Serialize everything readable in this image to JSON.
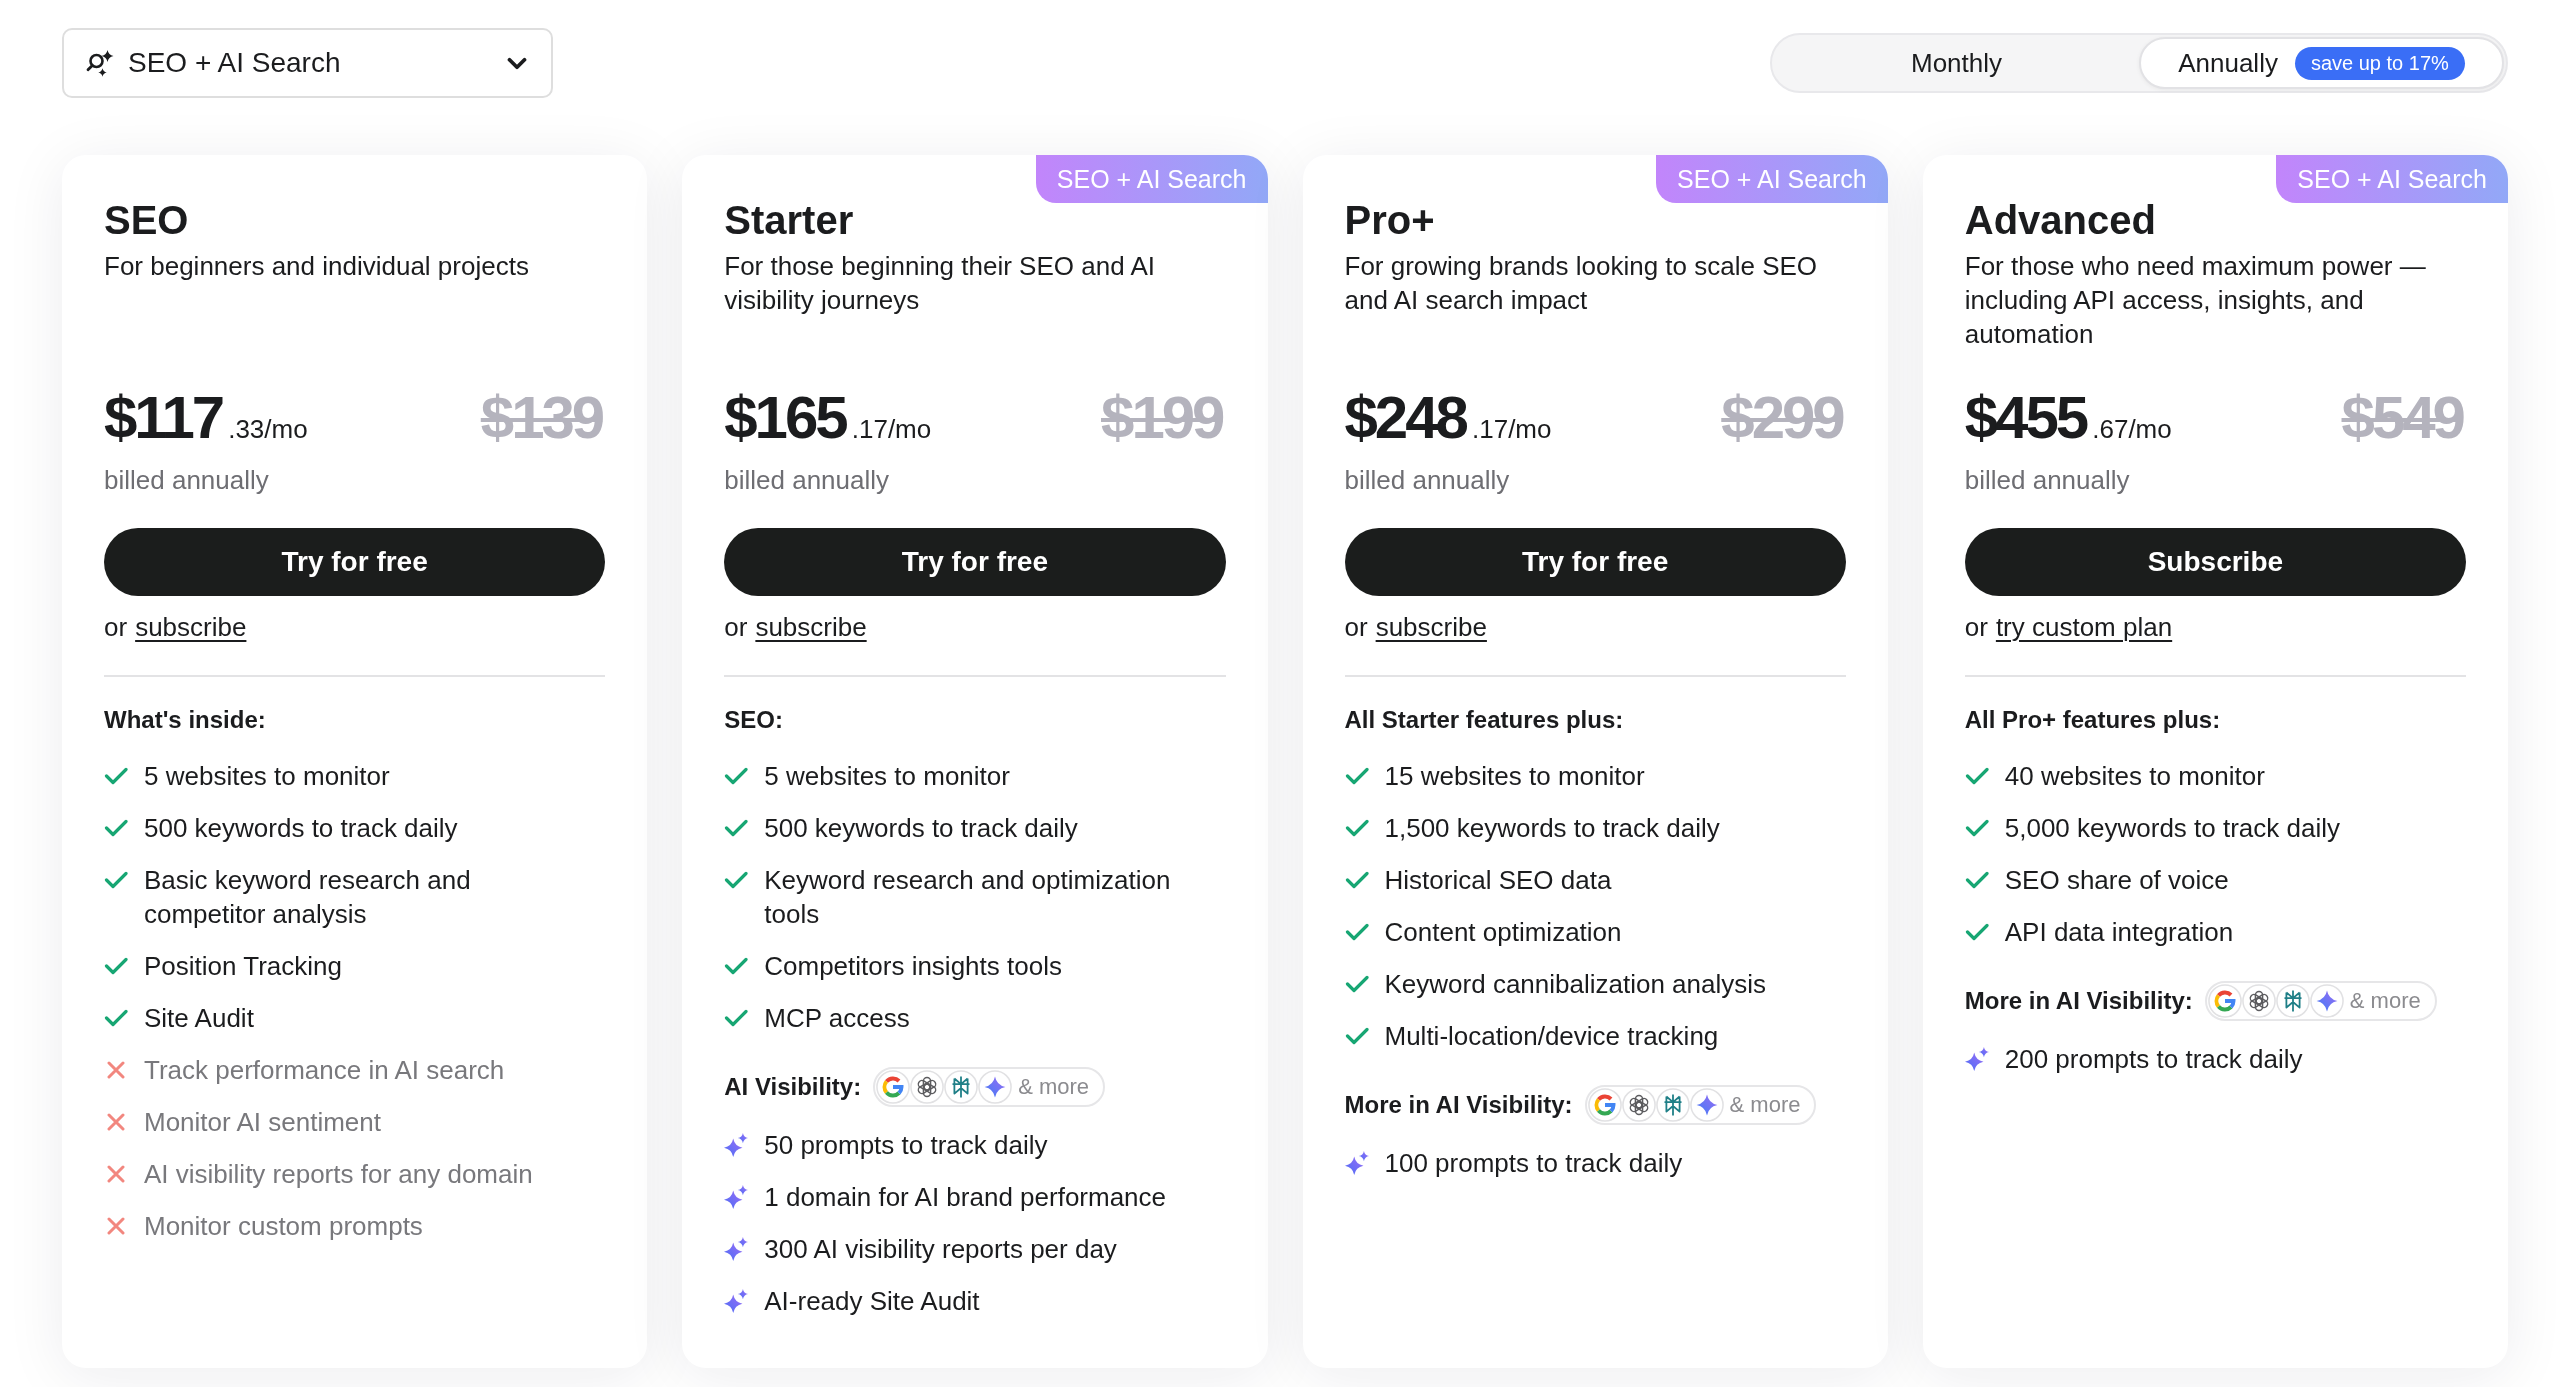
{
  "product_selector": {
    "value": "SEO + AI Search"
  },
  "billing_toggle": {
    "options": [
      {
        "label": "Monthly",
        "selected": false
      },
      {
        "label": "Annually",
        "selected": true,
        "badge": "save up to 17%"
      }
    ]
  },
  "plans": [
    {
      "name": "SEO",
      "description": "For beginners and individual projects",
      "price": "$117",
      "price_suffix": ".33/mo",
      "old_price": "$139",
      "billing": "billed annually",
      "cta": "Try for free",
      "alt_prefix": "or",
      "alt_link": "subscribe",
      "features": [
        {
          "kind": "heading",
          "text": "What's inside:"
        },
        {
          "kind": "included",
          "text": "5 websites to monitor"
        },
        {
          "kind": "included",
          "text": "500 keywords to track daily"
        },
        {
          "kind": "included",
          "text": "Basic keyword research and competitor analysis"
        },
        {
          "kind": "included",
          "text": "Position Tracking"
        },
        {
          "kind": "included",
          "text": "Site Audit"
        },
        {
          "kind": "excluded",
          "text": "Track performance in AI search"
        },
        {
          "kind": "excluded",
          "text": "Monitor AI sentiment"
        },
        {
          "kind": "excluded",
          "text": "AI visibility reports for any domain"
        },
        {
          "kind": "excluded",
          "text": "Monitor custom prompts"
        }
      ]
    },
    {
      "badge": "SEO + AI Search",
      "name": "Starter",
      "description": "For those beginning their SEO and AI visibility journeys",
      "price": "$165",
      "price_suffix": ".17/mo",
      "old_price": "$199",
      "billing": "billed annually",
      "cta": "Try for free",
      "alt_prefix": "or",
      "alt_link": "subscribe",
      "features": [
        {
          "kind": "heading",
          "text": "SEO:"
        },
        {
          "kind": "included",
          "text": "5 websites to monitor"
        },
        {
          "kind": "included",
          "text": "500 keywords to track daily"
        },
        {
          "kind": "included",
          "text": "Keyword research and optimization tools"
        },
        {
          "kind": "included",
          "text": "Competitors insights tools"
        },
        {
          "kind": "included",
          "text": "MCP access"
        },
        {
          "kind": "ai_heading",
          "text": "AI Visibility:",
          "more": "& more"
        },
        {
          "kind": "ai",
          "text": "50 prompts to track daily"
        },
        {
          "kind": "ai",
          "text": "1 domain for AI brand performance"
        },
        {
          "kind": "ai",
          "text": "300 AI visibility reports per day"
        },
        {
          "kind": "ai",
          "text": "AI-ready Site Audit"
        }
      ]
    },
    {
      "badge": "SEO + AI Search",
      "name": "Pro+",
      "description": "For growing brands looking to scale SEO and AI search impact",
      "price": "$248",
      "price_suffix": ".17/mo",
      "old_price": "$299",
      "billing": "billed annually",
      "cta": "Try for free",
      "alt_prefix": "or",
      "alt_link": "subscribe",
      "features": [
        {
          "kind": "heading",
          "text": "All Starter features plus:"
        },
        {
          "kind": "included",
          "text": "15 websites to monitor"
        },
        {
          "kind": "included",
          "text": "1,500 keywords to track daily"
        },
        {
          "kind": "included",
          "text": "Historical SEO data"
        },
        {
          "kind": "included",
          "text": "Content optimization"
        },
        {
          "kind": "included",
          "text": "Keyword cannibalization analysis"
        },
        {
          "kind": "included",
          "text": "Multi-location/device tracking"
        },
        {
          "kind": "ai_heading",
          "text": "More in AI Visibility:",
          "more": "& more"
        },
        {
          "kind": "ai",
          "text": "100 prompts to track daily"
        }
      ]
    },
    {
      "badge": "SEO + AI Search",
      "name": "Advanced",
      "description": "For those who need maximum power — including API access, insights, and automation",
      "price": "$455",
      "price_suffix": ".67/mo",
      "old_price": "$549",
      "billing": "billed annually",
      "cta": "Subscribe",
      "alt_prefix": "or",
      "alt_link": "try custom plan",
      "features": [
        {
          "kind": "heading",
          "text": "All Pro+ features plus:"
        },
        {
          "kind": "included",
          "text": "40 websites to monitor"
        },
        {
          "kind": "included",
          "text": "5,000 keywords to track daily"
        },
        {
          "kind": "included",
          "text": "SEO share of voice"
        },
        {
          "kind": "included",
          "text": "API data integration"
        },
        {
          "kind": "ai_heading",
          "text": "More in AI Visibility:",
          "more": "& more"
        },
        {
          "kind": "ai",
          "text": "200 prompts to track daily"
        }
      ]
    }
  ]
}
